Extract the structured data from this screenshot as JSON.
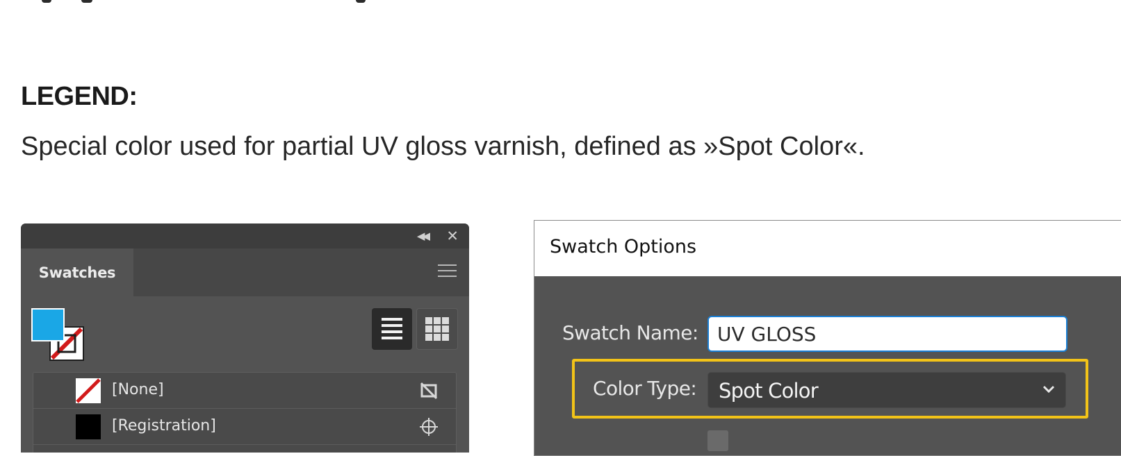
{
  "legend": {
    "title": "LEGEND:",
    "description": "Special color used for partial UV gloss varnish, defined as »Spot Color«."
  },
  "swatches_panel": {
    "tab_label": "Swatches",
    "fill_color": "#1aa7e6",
    "rows": [
      {
        "label": "[None]",
        "chip": "none",
        "icon": "no-edit-icon"
      },
      {
        "label": "[Registration]",
        "chip": "black",
        "icon": "registration-icon"
      }
    ]
  },
  "swatch_options": {
    "title": "Swatch Options",
    "name_label": "Swatch Name:",
    "name_value": "UV GLOSS",
    "type_label": "Color Type:",
    "type_value": "Spot Color",
    "highlight_color": "#f2c318"
  }
}
